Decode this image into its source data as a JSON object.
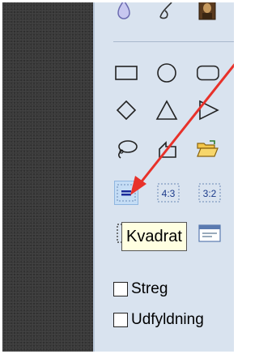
{
  "tooltip": {
    "text": "Kvadrat"
  },
  "tools": {
    "rectangle": "rectangle-tool",
    "ellipse": "ellipse-tool",
    "rounded_rectangle": "rounded-rectangle-tool",
    "diamond": "diamond-tool",
    "triangle": "triangle-tool",
    "arrow_triangle": "right-triangle-tool",
    "lasso": "lasso-tool",
    "freeform": "freeform-tool",
    "open_folder": "open-folder-tool",
    "aspect_square": "square-ratio-tool",
    "aspect_43": "4:3",
    "aspect_32": "3:2"
  },
  "options": {
    "stroke_label": "Streg",
    "stroke_checked": false,
    "fill_label": "Udfyldning",
    "fill_checked": false
  },
  "colors": {
    "panel_bg": "#d9e3ef",
    "arrow": "#e8312a",
    "selected_bg": "#c5ddf5",
    "tooltip_bg": "#ffffe1"
  }
}
